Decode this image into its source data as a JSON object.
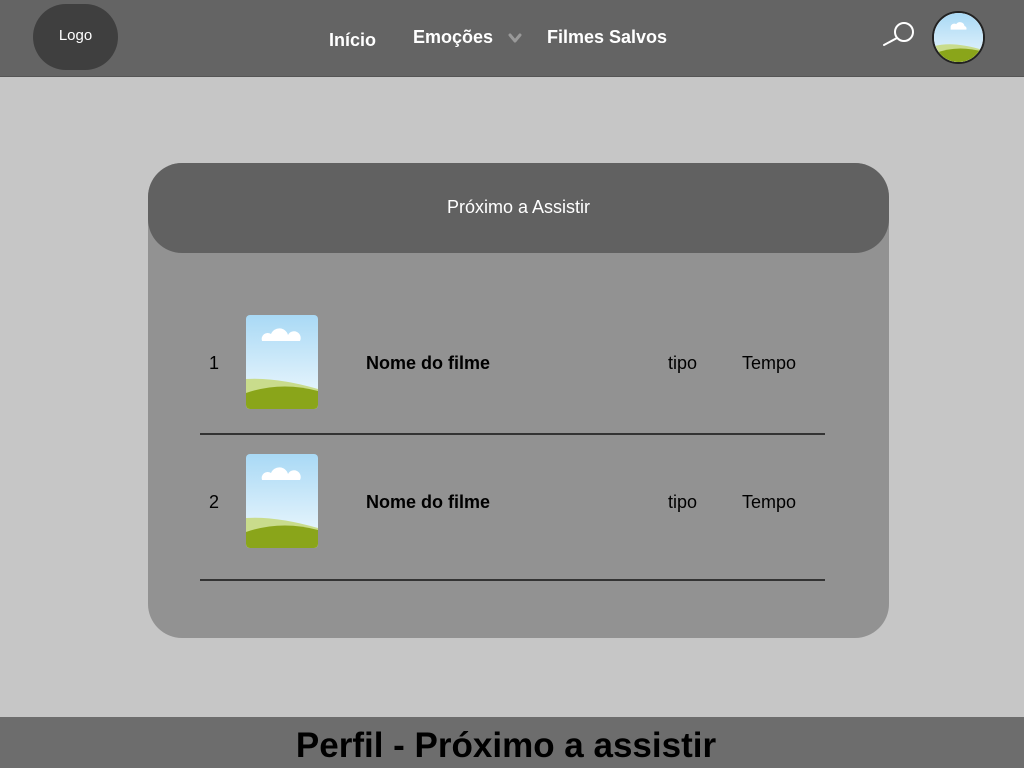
{
  "header": {
    "logo": "Logo",
    "nav": {
      "inicio": "Início",
      "emocoes": "Emoções",
      "filmes_salvos": "Filmes Salvos"
    },
    "icons": [
      "search-icon",
      "chevron-down-icon",
      "avatar"
    ]
  },
  "card": {
    "title": "Próximo a Assistir",
    "rows": [
      {
        "number": "1",
        "title": "Nome do filme",
        "type": "tipo",
        "time": "Tempo"
      },
      {
        "number": "2",
        "title": "Nome do filme",
        "type": "tipo",
        "time": "Tempo"
      }
    ]
  },
  "footer": {
    "title": "Perfil - Próximo a assistir"
  },
  "colors": {
    "background": "#c6c6c6",
    "header": "#646464",
    "card": "#929292",
    "card_header": "#616161",
    "footer": "#6d6d6d"
  }
}
